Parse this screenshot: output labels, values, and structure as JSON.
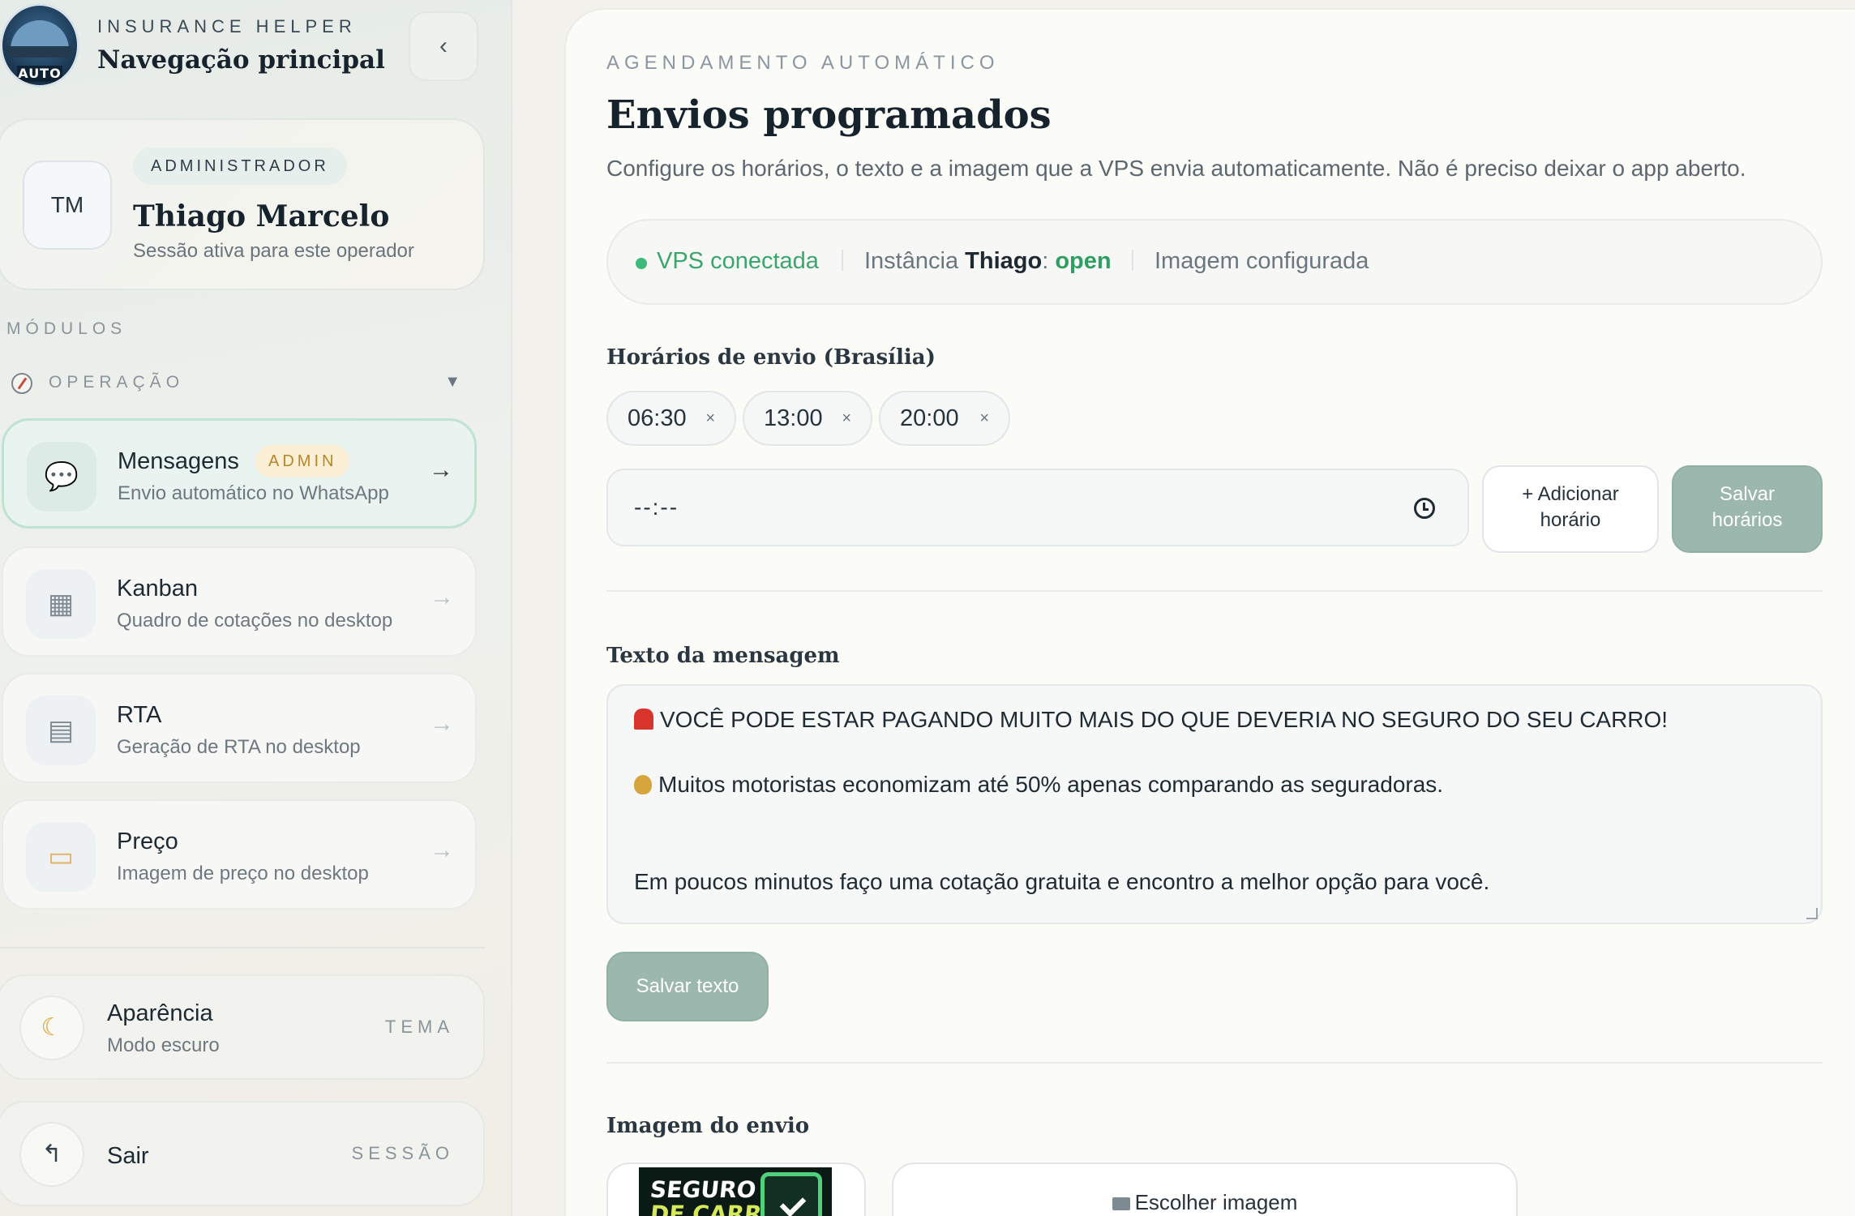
{
  "sidebar": {
    "brand_logo_text": "AUTO",
    "brand_kicker": "INSURANCE HELPER",
    "brand_title": "Navegação principal",
    "collapse_glyph": "‹",
    "profile": {
      "initials": "TM",
      "role": "ADMINISTRADOR",
      "name": "Thiago Marcelo",
      "subtitle": "Sessão ativa para este operador"
    },
    "modules_label": "MÓDULOS",
    "group": {
      "label": "OPERAÇÃO",
      "caret": "▼",
      "icon": "compass-icon"
    },
    "items": [
      {
        "title": "Mensagens",
        "subtitle": "Envio automático no WhatsApp",
        "badge": "ADMIN",
        "icon": "chat-bubble-icon",
        "glyph": "💬",
        "arrow": "→",
        "active": true
      },
      {
        "title": "Kanban",
        "subtitle": "Quadro de cotações no desktop",
        "icon": "grid-icon",
        "glyph": "▦",
        "arrow": "→"
      },
      {
        "title": "RTA",
        "subtitle": "Geração de RTA no desktop",
        "icon": "document-icon",
        "glyph": "▤",
        "arrow": "→"
      },
      {
        "title": "Preço",
        "subtitle": "Imagem de preço no desktop",
        "icon": "price-tag-icon",
        "glyph": "▭",
        "arrow": "→"
      }
    ],
    "appearance": {
      "title": "Aparência",
      "subtitle": "Modo escuro",
      "tag": "TEMA",
      "icon": "moon-icon",
      "glyph": "☾"
    },
    "logout": {
      "title": "Sair",
      "tag": "SESSÃO",
      "icon": "logout-icon",
      "glyph": "↰"
    }
  },
  "main": {
    "kicker": "AGENDAMENTO AUTOMÁTICO",
    "title": "Envios programados",
    "description": "Configure os horários, o texto e a imagem que a VPS envia automaticamente. Não é preciso deixar o app aberto.",
    "status": {
      "vps": "VPS conectada",
      "instance_prefix": "Instância ",
      "instance_name": "Thiago",
      "instance_colon": ": ",
      "instance_state": "open",
      "image": "Imagem configurada",
      "colors": {
        "connected": "#3aa66c",
        "open": "#2f9e63"
      }
    },
    "schedule": {
      "title": "Horários de envio (Brasília)",
      "times": [
        "06:30",
        "13:00",
        "20:00"
      ],
      "remove_glyph": "×",
      "input_value": "--:--",
      "add_button_line1": "+ Adicionar",
      "add_button_line2": "horário",
      "save_button_line1": "Salvar",
      "save_button_line2": "horários"
    },
    "message": {
      "title": "Texto da mensagem",
      "line1": "VOCÊ PODE ESTAR PAGANDO MUITO MAIS DO QUE DEVERIA NO SEGURO DO SEU CARRO!",
      "line2": "Muitos motoristas economizam até 50% apenas comparando as seguradoras.",
      "line3": "Em poucos minutos faço uma cotação gratuita e encontro a melhor opção para você.",
      "save_button": "Salvar texto"
    },
    "image": {
      "title": "Imagem do envio",
      "thumb_line1": "SEGURO",
      "thumb_line2": "DE CARRO",
      "choose_button": "Escolher imagem"
    },
    "accent": "#9cb8ae"
  }
}
